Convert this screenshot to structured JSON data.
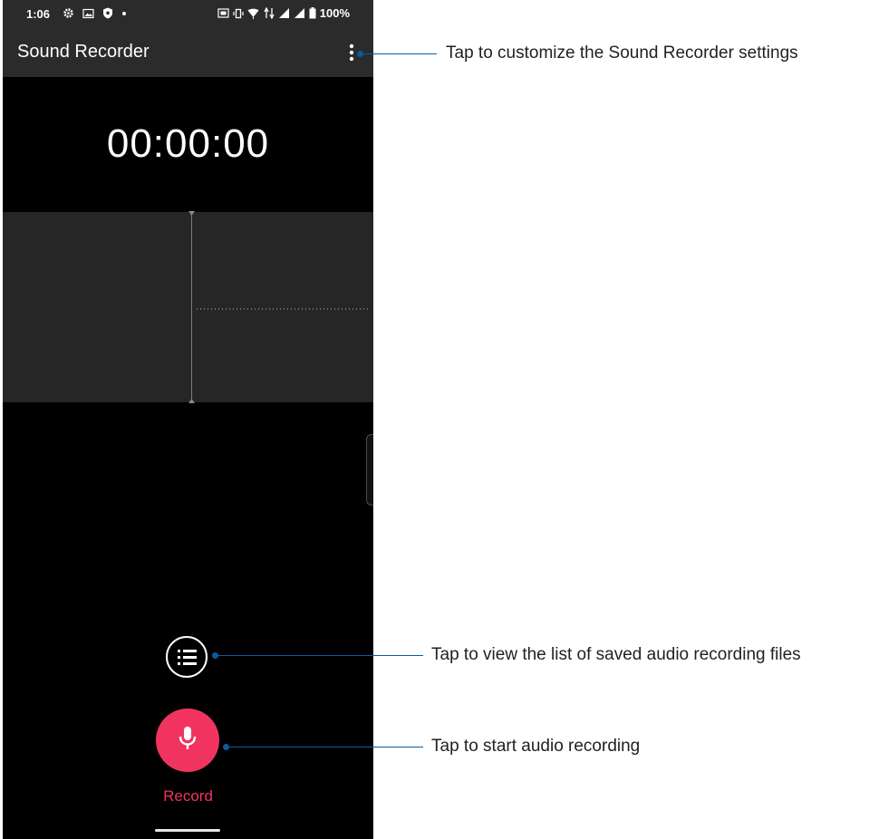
{
  "status_bar": {
    "time": "1:06",
    "left_icons": [
      "gear-icon",
      "image-icon",
      "shield-icon",
      "dot-icon"
    ],
    "right_icons": [
      "nfc-icon",
      "vibrate-icon",
      "wifi-icon",
      "data-icon",
      "signal-icon",
      "signal-icon",
      "battery-icon"
    ],
    "battery": "100%"
  },
  "app_bar": {
    "title": "Sound Recorder",
    "menu_icon": "more-vert-icon"
  },
  "timer": {
    "value": "00:00:00"
  },
  "controls": {
    "list_icon": "list-icon",
    "record_icon": "microphone-icon",
    "record_label": "Record"
  },
  "annotations": {
    "settings": "Tap to customize the Sound Recorder settings",
    "list": "Tap to view the list of saved audio recording files",
    "record": "Tap to start audio recording"
  },
  "colors": {
    "accent": "#f1345f",
    "leader": "#0b5a9e",
    "bar": "#2b2b2b",
    "waveform_panel": "#262626"
  }
}
